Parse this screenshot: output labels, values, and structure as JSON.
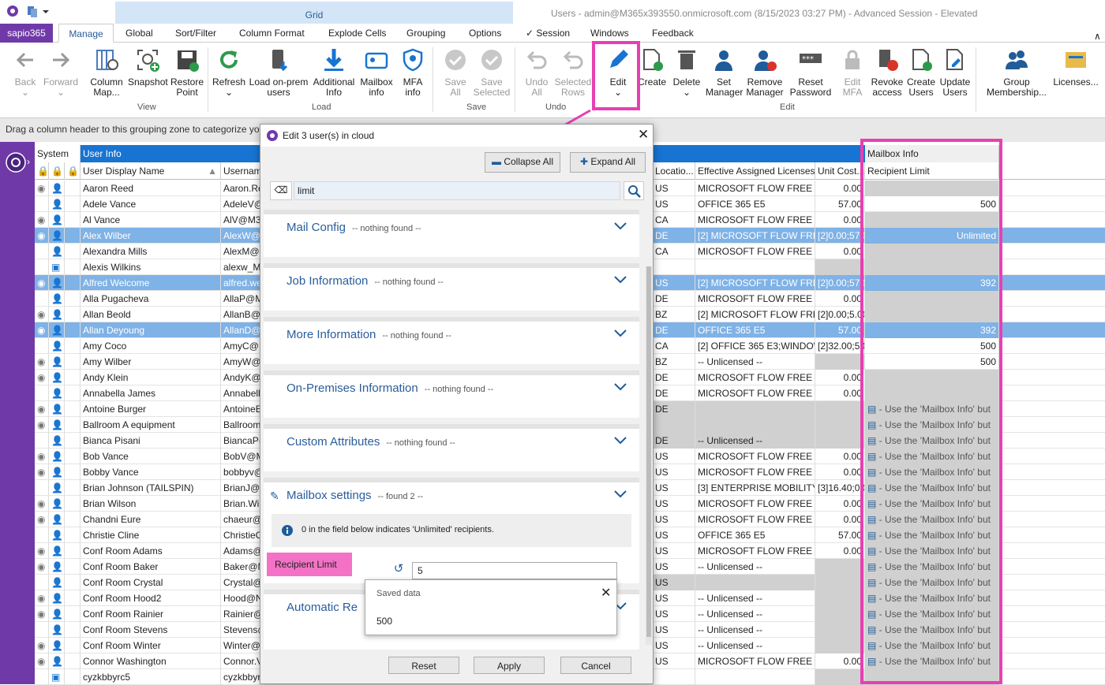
{
  "window": {
    "title": "Users - admin@M365x393550.onmicrosoft.com (8/15/2023 03:27 PM) - Advanced Session - Elevated",
    "context_tab": "Grid"
  },
  "tabs": [
    "sapio365",
    "Manage",
    "Global",
    "Sort/Filter",
    "Column Format",
    "Explode Cells",
    "Grouping",
    "Options",
    "Session",
    "Windows",
    "Feedback"
  ],
  "ribbon": {
    "back": "Back",
    "forward": "Forward",
    "column_map": "Column Map...",
    "snapshot": "Snapshot",
    "restore_point": "Restore Point",
    "group_view": "View",
    "refresh": "Refresh",
    "load_onprem": "Load on-prem users",
    "additional_info": "Additional Info",
    "mailbox_info": "Mailbox info",
    "mfa_info": "MFA info",
    "group_load": "Load",
    "save_all": "Save All",
    "save_selected": "Save Selected",
    "group_save": "Save",
    "undo_all": "Undo All",
    "selected_rows": "Selected Rows",
    "group_undo": "Undo",
    "edit": "Edit",
    "create": "Create",
    "delete": "Delete",
    "set_manager": "Set Manager",
    "remove_manager": "Remove Manager",
    "reset_password": "Reset Password",
    "edit_mfa": "Edit MFA",
    "revoke_access": "Revoke access",
    "create_users": "Create Users",
    "update_users": "Update Users",
    "group_edit": "Edit",
    "group_membership": "Group Membership...",
    "licenses": "Licenses..."
  },
  "grouping_hint": "Drag a column header to this grouping zone to categorize yo",
  "grid": {
    "bands": {
      "system": "System",
      "user_info": "User Info",
      "mailbox_info": "Mailbox Info"
    },
    "columns": {
      "display_name": "User Display Name",
      "username": "Usernam",
      "location": "Locatio...",
      "licenses": "Effective Assigned Licenses",
      "unit_cost": "Unit Cost...",
      "recipient_limit": "Recipient Limit"
    },
    "mailbox_hint": "- Use the 'Mailbox Info' but",
    "rows": [
      {
        "name": "Aaron Reed",
        "user": "Aaron.Re",
        "loc": "US",
        "lic": "MICROSOFT FLOW FREE",
        "cost": "0.00",
        "rl": "",
        "st": "n"
      },
      {
        "name": "Adele Vance",
        "user": "AdeleV@",
        "loc": "US",
        "lic": "OFFICE 365 E5",
        "cost": "57.00",
        "rl": "500",
        "st": "w"
      },
      {
        "name": "Al Vance",
        "user": "AlV@M3",
        "loc": "CA",
        "lic": "MICROSOFT FLOW FREE",
        "cost": "0.00",
        "rl": "",
        "st": "n"
      },
      {
        "name": "Alex Wilber",
        "user": "AlexW@",
        "loc": "DE",
        "lic": "[2] MICROSOFT FLOW FREE;",
        "cost": "[2]0.00;57.0",
        "rl": "Unlimited",
        "st": "s"
      },
      {
        "name": "Alexandra Mills",
        "user": "AlexM@",
        "loc": "CA",
        "lic": "MICROSOFT FLOW FREE",
        "cost": "0.00",
        "rl": "",
        "st": "n"
      },
      {
        "name": "Alexis Wilkins",
        "user": "alexw_M",
        "loc": "",
        "lic": "",
        "cost": "",
        "rl": "",
        "st": "b"
      },
      {
        "name": "Alfred Welcome",
        "user": "alfred.we",
        "loc": "US",
        "lic": "[2] MICROSOFT FLOW FREE;",
        "cost": "[2]0.00;57.0",
        "rl": "392",
        "st": "s"
      },
      {
        "name": "Alla Pugacheva",
        "user": "AllaP@M",
        "loc": "DE",
        "lic": "MICROSOFT FLOW FREE",
        "cost": "0.00",
        "rl": "",
        "st": "n"
      },
      {
        "name": "Allan Beold",
        "user": "AllanB@",
        "loc": "BZ",
        "lic": "[2] MICROSOFT FLOW FREE;",
        "cost": "[2]0.00;5.00",
        "rl": "",
        "st": "n"
      },
      {
        "name": "Allan Deyoung",
        "user": "AllanD@",
        "loc": "DE",
        "lic": "OFFICE 365 E5",
        "cost": "57.00",
        "rl": "392",
        "st": "s"
      },
      {
        "name": "Amy Coco",
        "user": "AmyC@",
        "loc": "CA",
        "lic": "[2] OFFICE 365 E3;WINDOWS",
        "cost": "[2]32.00;5.0",
        "rl": "500",
        "st": "w"
      },
      {
        "name": "Amy Wilber",
        "user": "AmyW@",
        "loc": "BZ",
        "lic": "-- Unlicensed --",
        "cost": "",
        "rl": "500",
        "st": "w"
      },
      {
        "name": "Andy Klein",
        "user": "AndyK@",
        "loc": "DE",
        "lic": "MICROSOFT FLOW FREE",
        "cost": "0.00",
        "rl": "",
        "st": "n"
      },
      {
        "name": "Annabella James",
        "user": "Annabell",
        "loc": "DE",
        "lic": "MICROSOFT FLOW FREE",
        "cost": "0.00",
        "rl": "",
        "st": "n"
      },
      {
        "name": "Antoine Burger",
        "user": "AntoineE",
        "loc": "DE",
        "lic": "",
        "cost": "",
        "rl": "h",
        "st": "g"
      },
      {
        "name": "Ballroom A equipment",
        "user": "Ballroom",
        "loc": "",
        "lic": "",
        "cost": "",
        "rl": "h",
        "st": "g"
      },
      {
        "name": "Bianca Pisani",
        "user": "BiancaP@",
        "loc": "DE",
        "lic": "-- Unlicensed --",
        "cost": "",
        "rl": "h",
        "st": "g"
      },
      {
        "name": "Bob Vance",
        "user": "BobV@M",
        "loc": "US",
        "lic": "MICROSOFT FLOW FREE",
        "cost": "0.00",
        "rl": "h",
        "st": "n"
      },
      {
        "name": "Bobby Vance",
        "user": "bobbyv@",
        "loc": "US",
        "lic": "MICROSOFT FLOW FREE",
        "cost": "0.00",
        "rl": "h",
        "st": "n"
      },
      {
        "name": "Brian Johnson (TAILSPIN)",
        "user": "BrianJ@M",
        "loc": "US",
        "lic": "[3] ENTERPRISE MOBILITY +",
        "cost": "[3]16.40;0.0",
        "rl": "h",
        "st": "n"
      },
      {
        "name": "Brian Wilson",
        "user": "Brian.Wi",
        "loc": "US",
        "lic": "MICROSOFT FLOW FREE",
        "cost": "0.00",
        "rl": "h",
        "st": "n"
      },
      {
        "name": "Chandni Eure",
        "user": "chaeur@",
        "loc": "US",
        "lic": "MICROSOFT FLOW FREE",
        "cost": "0.00",
        "rl": "h",
        "st": "n"
      },
      {
        "name": "Christie Cline",
        "user": "ChristieC",
        "loc": "US",
        "lic": "OFFICE 365 E5",
        "cost": "57.00",
        "rl": "h",
        "st": "n"
      },
      {
        "name": "Conf Room Adams",
        "user": "Adams@",
        "loc": "US",
        "lic": "MICROSOFT FLOW FREE",
        "cost": "0.00",
        "rl": "h",
        "st": "n"
      },
      {
        "name": "Conf Room Baker",
        "user": "Baker@M",
        "loc": "US",
        "lic": "-- Unlicensed --",
        "cost": "",
        "rl": "h",
        "st": "n"
      },
      {
        "name": "Conf Room Crystal",
        "user": "Crystal@",
        "loc": "US",
        "lic": "",
        "cost": "",
        "rl": "h",
        "st": "g"
      },
      {
        "name": "Conf Room Hood2",
        "user": "Hood@N",
        "loc": "US",
        "lic": "-- Unlicensed --",
        "cost": "",
        "rl": "h",
        "st": "n"
      },
      {
        "name": "Conf Room Rainier",
        "user": "Rainier@",
        "loc": "US",
        "lic": "-- Unlicensed --",
        "cost": "",
        "rl": "h",
        "st": "n"
      },
      {
        "name": "Conf Room Stevens",
        "user": "Stevens@",
        "loc": "US",
        "lic": "-- Unlicensed --",
        "cost": "",
        "rl": "h",
        "st": "n"
      },
      {
        "name": "Conf Room Winter",
        "user": "Winter@",
        "loc": "US",
        "lic": "-- Unlicensed --",
        "cost": "",
        "rl": "h",
        "st": "n"
      },
      {
        "name": "Connor Washington",
        "user": "Connor.V",
        "loc": "US",
        "lic": "MICROSOFT FLOW FREE",
        "cost": "0.00",
        "rl": "h",
        "st": "n"
      },
      {
        "name": "cyzkbbyrc5",
        "user": "cyzkbbyr",
        "loc": "",
        "lic": "",
        "cost": "",
        "rl": "",
        "st": "b"
      }
    ]
  },
  "dialog": {
    "title": "Edit 3 user(s) in cloud",
    "collapse_all": "Collapse All",
    "expand_all": "Expand All",
    "search_value": "limit",
    "sections": [
      {
        "title": "Mail Config",
        "status": "-- nothing found --"
      },
      {
        "title": "Job Information",
        "status": "-- nothing found --"
      },
      {
        "title": "More Information",
        "status": "-- nothing found --"
      },
      {
        "title": "On-Premises Information",
        "status": "-- nothing found --"
      },
      {
        "title": "Custom Attributes",
        "status": "-- nothing found --"
      },
      {
        "title": "Mailbox settings",
        "status": "-- found 2 --"
      },
      {
        "title": "Automatic Re",
        "status": ""
      }
    ],
    "info_text": "0 in the field below indicates 'Unlimited' recipients.",
    "field_label": "Recipient Limit",
    "field_value": "5",
    "popup_title": "Saved data",
    "popup_value": "500",
    "reset": "Reset",
    "apply": "Apply",
    "cancel": "Cancel"
  },
  "colors": {
    "accent": "#6f3aa8",
    "highlight": "#e83fb3",
    "selection": "#7fb2e6",
    "header_blue": "#1874d2"
  }
}
